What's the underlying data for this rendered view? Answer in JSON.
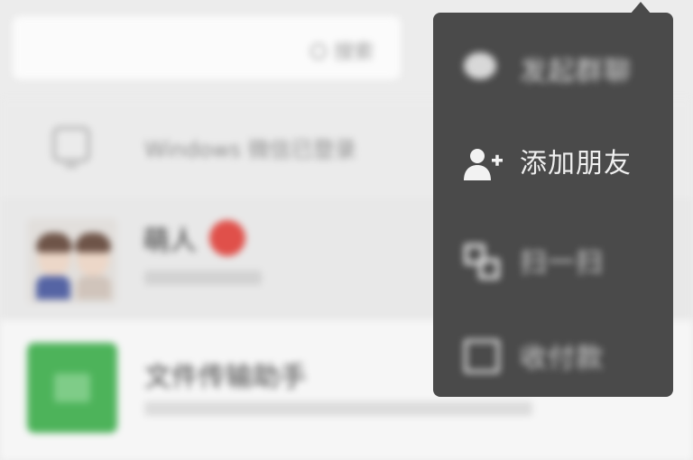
{
  "search": {
    "placeholder": "搜索"
  },
  "chat_list": {
    "pc_row": {
      "text": "Windows 微信已登录"
    },
    "contact_row": {
      "name": "萌人"
    },
    "file_row": {
      "name": "文件传输助手"
    }
  },
  "popup_menu": {
    "items": [
      {
        "label": "发起群聊",
        "icon": "chat-bubble-icon"
      },
      {
        "label": "添加朋友",
        "icon": "add-friend-icon"
      },
      {
        "label": "扫一扫",
        "icon": "scan-icon"
      },
      {
        "label": "收付款",
        "icon": "payment-icon"
      }
    ]
  },
  "colors": {
    "popup_bg": "#4a4a4a",
    "menu_text": "#efefef",
    "file_icon_green": "#4db35a",
    "heart_red": "#e0504a"
  }
}
